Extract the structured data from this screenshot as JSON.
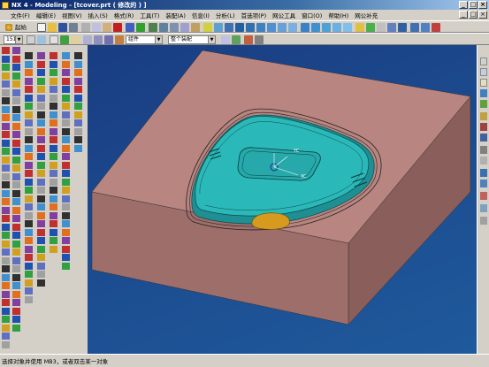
{
  "window": {
    "title": "NX 4 - Modeling - [tcover.prt ( 修改的 ) ]",
    "minimize": "_",
    "maximize": "□",
    "close": "×"
  },
  "menu": {
    "items": [
      "文件(F)",
      "编辑(E)",
      "视图(V)",
      "插入(S)",
      "格式(R)",
      "工具(T)",
      "装配(A)",
      "信息(I)",
      "分析(L)",
      "首选项(P)",
      "网公工具",
      "窗口(O)",
      "帮助(H)",
      "网公补充"
    ]
  },
  "toolbar": {
    "start_label": "起始",
    "layer_value": "151",
    "filter_value": "组件",
    "scope_value": "整个装配"
  },
  "viewport": {
    "axis_yc": "YC",
    "axis_xc": "XC",
    "colors": {
      "background": "#1c4a8e",
      "mold_top": "#b88580",
      "mold_side_front": "#9e6e6a",
      "mold_side_right": "#8a5e5a",
      "part": "#2ab8b8",
      "gate": "#d69a1e"
    }
  },
  "statusbar": {
    "prompt": "选择对象并使用 MB3，或者双击某一对象"
  }
}
